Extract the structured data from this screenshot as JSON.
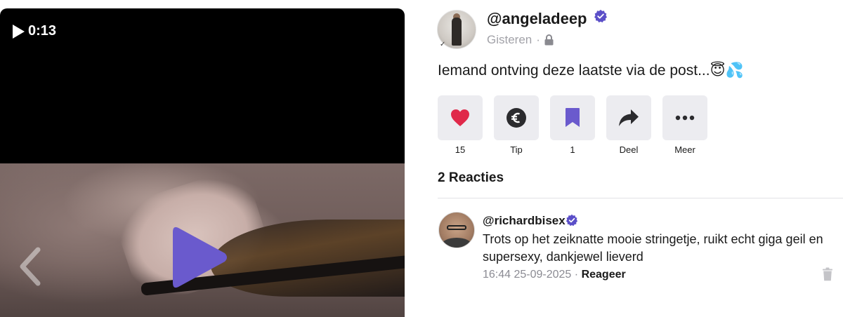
{
  "video": {
    "duration": "0:13",
    "icons": [
      "play-icon",
      "big-play-icon",
      "chevron-left-icon"
    ]
  },
  "post": {
    "username": "@angeladeep",
    "time": "Gisteren",
    "separator": "·",
    "text": "Iemand ontving deze laatste via de post...😇💦",
    "icons": [
      "verified-icon",
      "lock-icon"
    ]
  },
  "actions": [
    {
      "icon": "heart-icon",
      "label": "15",
      "color": "#e0294a"
    },
    {
      "icon": "euro-icon",
      "label": "Tip",
      "color": "#2b2b2e"
    },
    {
      "icon": "bookmark-icon",
      "label": "1",
      "color": "#6a5acd"
    },
    {
      "icon": "share-icon",
      "label": "Deel",
      "color": "#2b2b2e"
    },
    {
      "icon": "more-icon",
      "label": "Meer",
      "color": "#2b2b2e"
    }
  ],
  "comments_title": "2 Reacties",
  "comment": {
    "username": "@richardbisex",
    "text": "Trots op het zeiknatte mooie stringetje, ruikt echt giga geil en supersexy, dankjewel lieverd",
    "timestamp": "16:44 25-09-2025",
    "separator": "·",
    "reply_label": "Reageer"
  },
  "colors": {
    "accent": "#6a5acd",
    "verified": "#5b4fc8",
    "button_bg": "#ececf0",
    "muted_text": "#a2a2a8"
  }
}
